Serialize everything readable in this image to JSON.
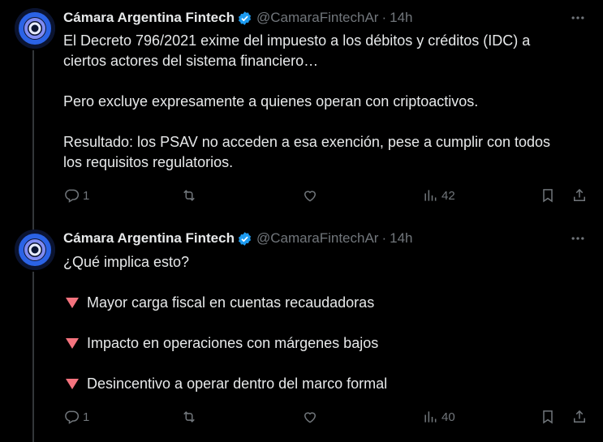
{
  "tweets": [
    {
      "author": {
        "name": "Cámara Argentina Fintech",
        "handle": "@CamaraFintechAr",
        "time": "14h",
        "separator": "·"
      },
      "lines": [
        "El Decreto 796/2021 exime del impuesto a los débitos y créditos (IDC) a",
        "ciertos actores del sistema financiero…",
        "",
        "Pero excluye expresamente a quienes operan con criptoactivos.",
        "",
        "Resultado: los PSAV no acceden a esa exención, pese a cumplir con todos",
        "los requisitos regulatorios."
      ],
      "stats": {
        "replies": "1",
        "views": "42"
      }
    },
    {
      "author": {
        "name": "Cámara Argentina Fintech",
        "handle": "@CamaraFintechAr",
        "time": "14h",
        "separator": "·"
      },
      "intro": "¿Qué implica esto?",
      "bullets": [
        "Mayor carga fiscal en cuentas recaudadoras",
        "Impacto en operaciones con márgenes bajos",
        "Desincentivo a operar dentro del marco formal"
      ],
      "stats": {
        "replies": "1",
        "views": "40"
      }
    }
  ],
  "colors": {
    "background": "#000000",
    "text": "#e7e9ea",
    "muted": "#71767b",
    "verified": "#1d9bf0",
    "bullet": "#f4737e",
    "thread_line": "#333639"
  },
  "icons": [
    "verified-badge-icon",
    "more-icon",
    "reply-icon",
    "retweet-icon",
    "like-icon",
    "views-icon",
    "bookmark-icon",
    "share-icon"
  ]
}
